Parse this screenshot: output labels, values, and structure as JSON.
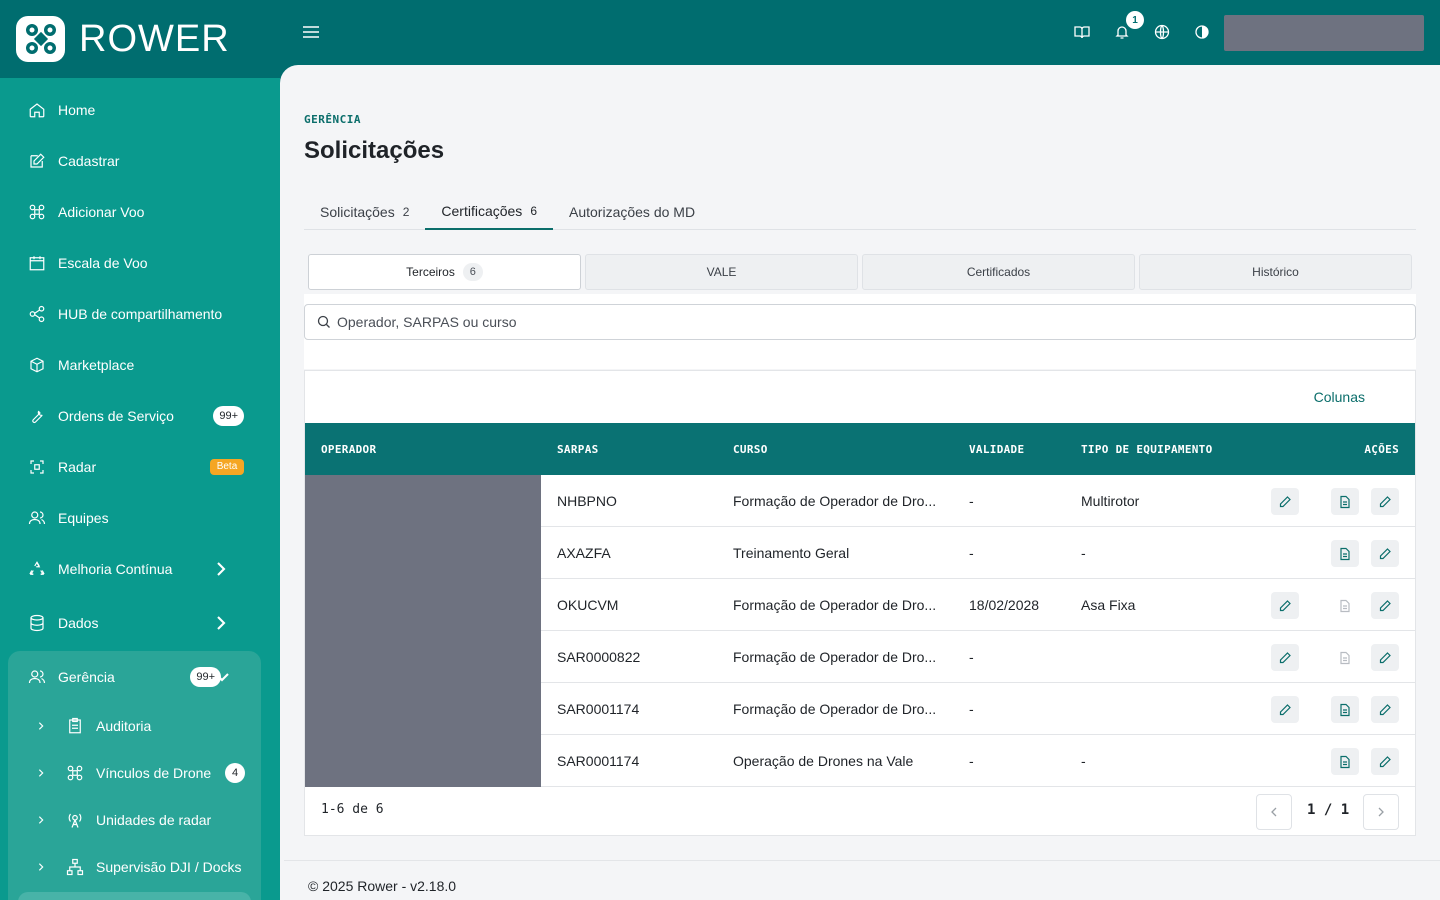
{
  "brand": {
    "name": "ROWER"
  },
  "sidebar": {
    "items": [
      {
        "label": "Home",
        "icon": "home-icon"
      },
      {
        "label": "Cadastrar",
        "icon": "edit-icon"
      },
      {
        "label": "Adicionar Voo",
        "icon": "drone-icon"
      },
      {
        "label": "Escala de Voo",
        "icon": "calendar-icon"
      },
      {
        "label": "HUB de compartilhamento",
        "icon": "share-icon"
      },
      {
        "label": "Marketplace",
        "icon": "box-icon"
      },
      {
        "label": "Ordens de Serviço",
        "icon": "wrench-icon",
        "badge": "99+"
      },
      {
        "label": "Radar",
        "icon": "radar-icon",
        "badge": "Beta"
      },
      {
        "label": "Equipes",
        "icon": "users-icon"
      },
      {
        "label": "Melhoria Contínua",
        "icon": "recycle-icon"
      },
      {
        "label": "Dados",
        "icon": "database-icon"
      }
    ],
    "group": {
      "label": "Gerência",
      "badge": "99+",
      "children": [
        {
          "label": "Auditoria",
          "icon": "clipboard-icon"
        },
        {
          "label": "Vínculos de Drone",
          "icon": "drone-icon",
          "badge": "4"
        },
        {
          "label": "Unidades de radar",
          "icon": "antenna-icon"
        },
        {
          "label": "Supervisão DJI / Docks",
          "icon": "network-icon"
        }
      ]
    }
  },
  "topbar": {
    "notifications": "1"
  },
  "page": {
    "breadcrumb": "GERÊNCIA",
    "title": "Solicitações",
    "tabs": [
      {
        "label": "Solicitações",
        "count": "2"
      },
      {
        "label": "Certificações",
        "count": "6"
      },
      {
        "label": "Autorizações do MD",
        "count": ""
      }
    ],
    "segments": [
      {
        "label": "Terceiros",
        "count": "6"
      },
      {
        "label": "VALE"
      },
      {
        "label": "Certificados"
      },
      {
        "label": "Histórico"
      }
    ],
    "search_placeholder": "Operador, SARPAS ou curso",
    "columns_button": "Colunas",
    "headers": {
      "operador": "OPERADOR",
      "sarpas": "SARPAS",
      "curso": "CURSO",
      "validade": "VALIDADE",
      "tipo": "TIPO DE EQUIPAMENTO",
      "acoes": "AÇÕES"
    },
    "rows": [
      {
        "sarpas": "NHBPNO",
        "curso": "Formação de Operador de Dro...",
        "validade": "-",
        "tipo": "Multirotor"
      },
      {
        "sarpas": "AXAZFA",
        "curso": "Treinamento Geral",
        "validade": "-",
        "tipo": "-"
      },
      {
        "sarpas": "OKUCVM",
        "curso": "Formação de Operador de Dro...",
        "validade": "18/02/2028",
        "tipo": "Asa Fixa"
      },
      {
        "sarpas": "SAR0000822",
        "curso": "Formação de Operador de Dro...",
        "validade": "-",
        "tipo": ""
      },
      {
        "sarpas": "SAR0001174",
        "curso": "Formação de Operador de Dro...",
        "validade": "-",
        "tipo": ""
      },
      {
        "sarpas": "SAR0001174",
        "curso": "Operação de Drones na Vale",
        "validade": "-",
        "tipo": "-"
      }
    ],
    "pagination": {
      "range": "1-6 de 6",
      "page": "1 / 1"
    },
    "footer": "© 2025 Rower - v2.18.0"
  },
  "colors": {
    "primary": "#006d6f",
    "sidebar": "#0a9a8e",
    "table_header": "#0a7273",
    "accent": "#0b6e6b"
  }
}
